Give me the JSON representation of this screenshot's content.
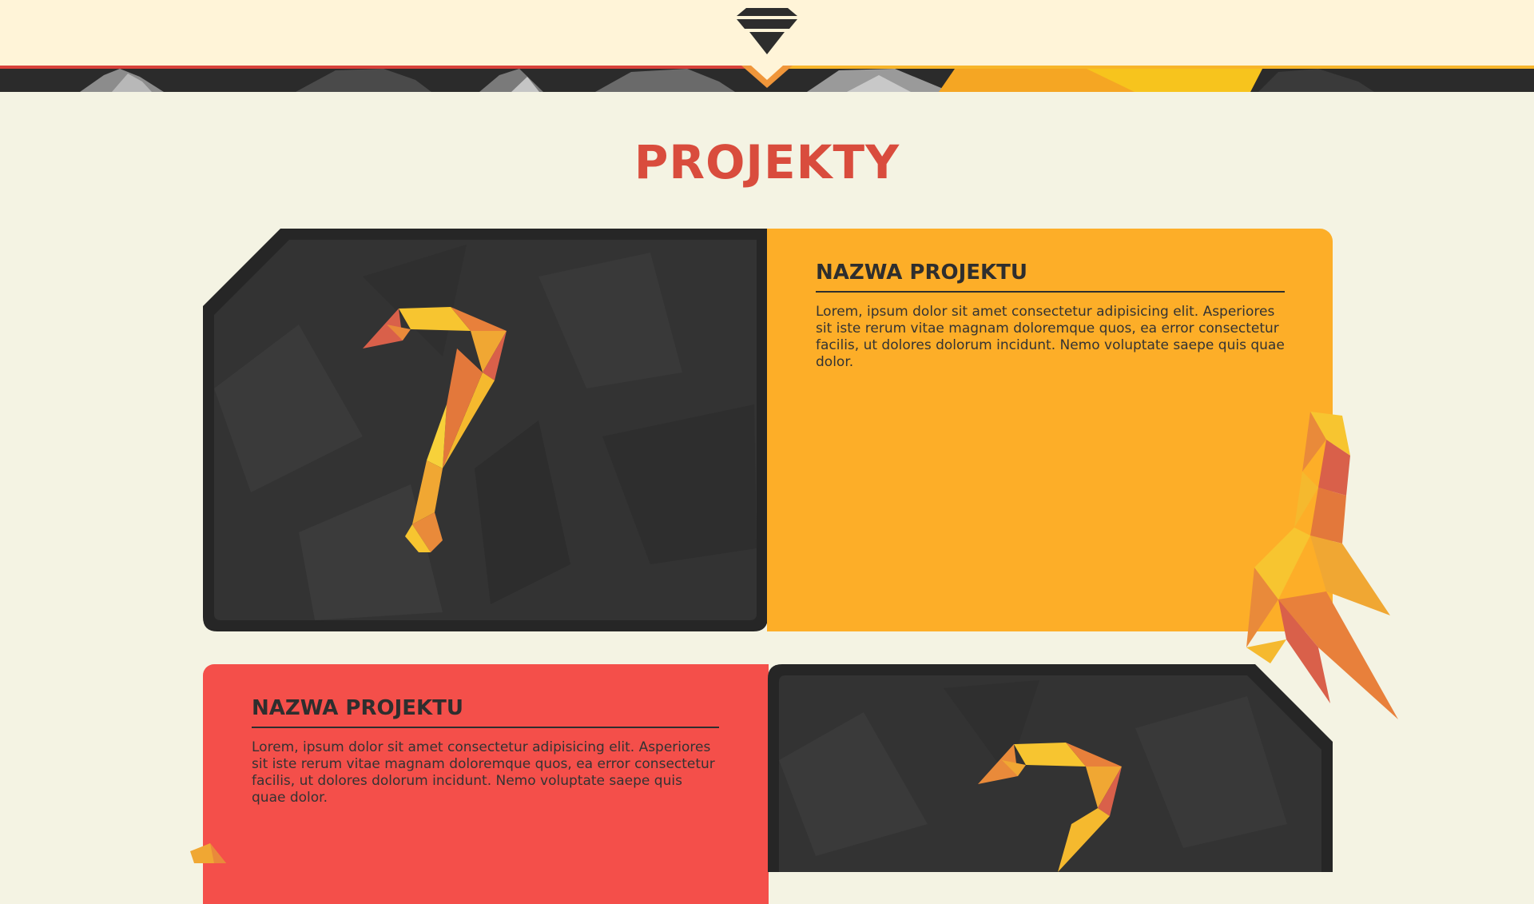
{
  "header": {
    "logo_icon": "inverted-triangle-logo-icon",
    "band_colors": {
      "dark": "#2b2b2b",
      "orange": "#f5a623",
      "red": "#e0433a",
      "yellow": "#f7c41d"
    }
  },
  "section": {
    "title": "PROJEKTY",
    "title_color": "#d94c3d"
  },
  "projects": [
    {
      "name": "NAZWA PROJEKTU",
      "description": "Lorem, ipsum dolor sit amet consectetur adipisicing elit. Asperiores sit iste rerum vitae magnam doloremque quos, ea error consectetur facilis, ut dolores dolorum incidunt. Nemo voluptate saepe quis quae dolor.",
      "panel_color": "#fdae28",
      "image_icon": "lowpoly-question-mark-icon"
    },
    {
      "name": "NAZWA PROJEKTU",
      "description": "Lorem, ipsum dolor sit amet consectetur adipisicing elit. Asperiores sit iste rerum vitae magnam doloremque quos, ea error consectetur facilis, ut dolores dolorum incidunt. Nemo voluptate saepe quis quae dolor.",
      "panel_color": "#f44f4a",
      "image_icon": "lowpoly-question-mark-icon"
    }
  ],
  "decorations": {
    "shard_icon": "lowpoly-flame-shard-icon"
  }
}
